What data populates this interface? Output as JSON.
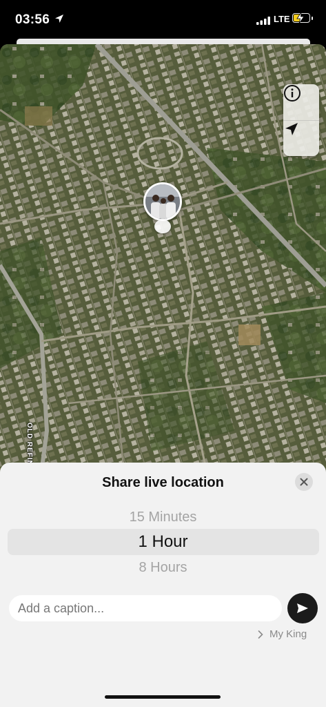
{
  "status_bar": {
    "time": "03:56",
    "network": "LTE",
    "battery_level": 0.4
  },
  "map": {
    "road_label": "OLD REFINERY ROAD",
    "controls": {
      "info_icon": "info-icon",
      "locate_icon": "location-arrow-icon"
    }
  },
  "sheet": {
    "title": "Share live location",
    "close_icon": "close-icon",
    "durations": [
      "15 Minutes",
      "1 Hour",
      "8 Hours"
    ],
    "selected_duration": "1 Hour",
    "caption_placeholder": "Add a caption...",
    "send_icon": "send-icon",
    "recipient": "My King"
  },
  "colors": {
    "sheet_bg": "#f2f2f2",
    "send_button": "#1b1b1b",
    "battery": "#f4cc1c"
  }
}
